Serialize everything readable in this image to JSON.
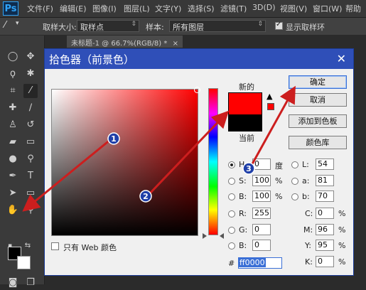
{
  "app": {
    "logo": "Ps"
  },
  "menu": [
    "文件(F)",
    "编辑(E)",
    "图像(I)",
    "图层(L)",
    "文字(Y)",
    "选择(S)",
    "滤镜(T)",
    "3D(D)",
    "视图(V)",
    "窗口(W)",
    "帮助"
  ],
  "options_bar": {
    "sample_size_label": "取样大小:",
    "sample_size_value": "取样点",
    "sample_label": "样本:",
    "sample_value": "所有图层",
    "show_ring_label": "显示取样环",
    "show_ring_checked": true
  },
  "document_tab": {
    "title": "未标题-1 @ 66.7%(RGB/8) *"
  },
  "dialog": {
    "title": "拾色器（前景色）",
    "new_label": "新的",
    "current_label": "当前",
    "buttons": {
      "ok": "确定",
      "cancel": "取消",
      "add_swatch": "添加到色板",
      "color_library": "颜色库"
    },
    "fields": {
      "H": {
        "label": "H:",
        "value": "0",
        "unit": "度",
        "checked": true
      },
      "S": {
        "label": "S:",
        "value": "100",
        "unit": "%"
      },
      "B": {
        "label": "B:",
        "value": "100",
        "unit": "%"
      },
      "R": {
        "label": "R:",
        "value": "255"
      },
      "G": {
        "label": "G:",
        "value": "0"
      },
      "Bl": {
        "label": "B:",
        "value": "0"
      },
      "L": {
        "label": "L:",
        "value": "54"
      },
      "a": {
        "label": "a:",
        "value": "81"
      },
      "b": {
        "label": "b:",
        "value": "70"
      },
      "C": {
        "label": "C:",
        "value": "0",
        "unit": "%"
      },
      "M": {
        "label": "M:",
        "value": "96",
        "unit": "%"
      },
      "Y": {
        "label": "Y:",
        "value": "95",
        "unit": "%"
      },
      "K": {
        "label": "K:",
        "value": "0",
        "unit": "%"
      }
    },
    "hex_prefix": "#",
    "hex_value": "ff0000",
    "web_only_label": "只有 Web 颜色",
    "new_color": "#ff0000",
    "current_color": "#000000"
  },
  "annotations": {
    "badge_1": "1",
    "badge_2": "2",
    "badge_3": "3",
    "arrow_color": "#cc1e1e",
    "badge_color": "#1f3fa8"
  },
  "colors": {
    "foreground": "#000000",
    "background": "#ffffff",
    "dialog_title_bg": "#2f4fb8"
  }
}
